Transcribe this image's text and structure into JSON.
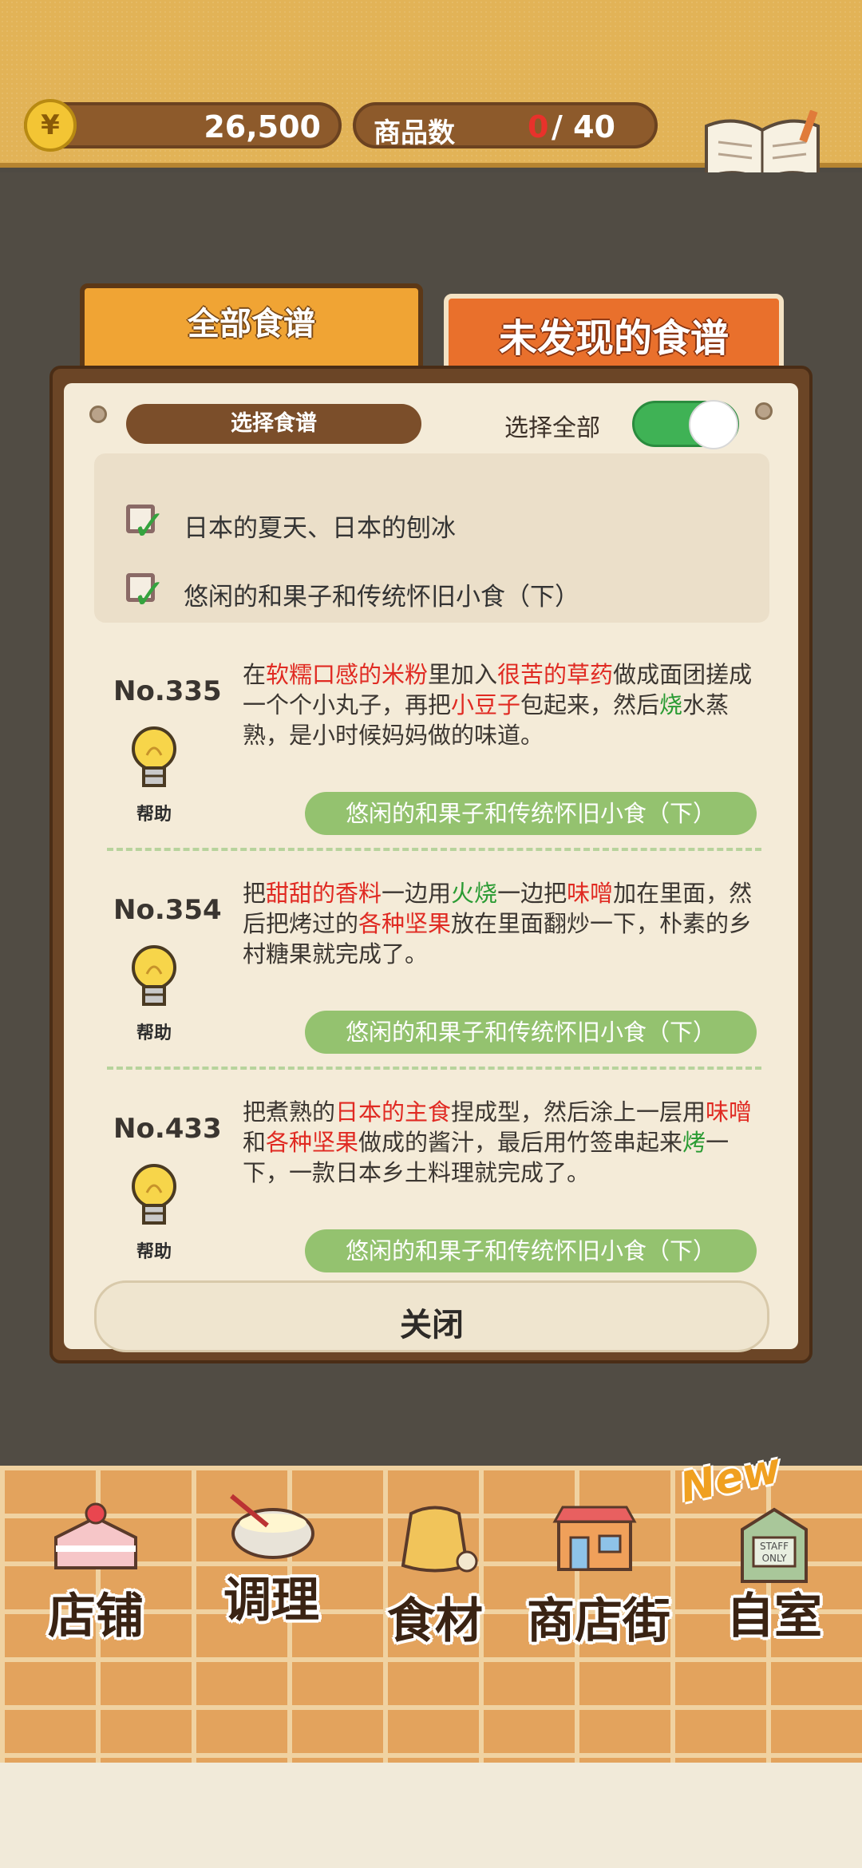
{
  "header": {
    "money": "26,500",
    "coin_symbol": "¥",
    "product_count_label": "商品数",
    "product_count_current": "0",
    "product_count_total": "/ 40",
    "recipe_button_label": "食谱"
  },
  "tabs": [
    {
      "label": "全部食谱",
      "active": false
    },
    {
      "label": "未发现的食谱",
      "active": true
    }
  ],
  "filter": {
    "select_label": "选择食谱",
    "select_all_label": "选择全部",
    "select_all_on": true,
    "items": [
      {
        "label": "日本的夏天、日本的刨冰",
        "checked": true
      },
      {
        "label": "悠闲的和果子和传统怀旧小食（下）",
        "checked": true
      }
    ]
  },
  "hint_label": "帮助",
  "recipes": [
    {
      "no": "No.335",
      "category": "悠闲的和果子和传统怀旧小食（下）",
      "desc_parts": [
        {
          "t": "在",
          "c": ""
        },
        {
          "t": "软糯口感的米粉",
          "c": "red"
        },
        {
          "t": "里加入",
          "c": ""
        },
        {
          "t": "很苦的草药",
          "c": "red"
        },
        {
          "t": "做成面团搓成一个个小丸子，再把",
          "c": ""
        },
        {
          "t": "小豆子",
          "c": "red"
        },
        {
          "t": "包起来，然后",
          "c": ""
        },
        {
          "t": "烧",
          "c": "green"
        },
        {
          "t": "水蒸熟，是小时候妈妈做的味道。",
          "c": ""
        }
      ]
    },
    {
      "no": "No.354",
      "category": "悠闲的和果子和传统怀旧小食（下）",
      "desc_parts": [
        {
          "t": "把",
          "c": ""
        },
        {
          "t": "甜甜的香料",
          "c": "red"
        },
        {
          "t": "一边用",
          "c": ""
        },
        {
          "t": "火烧",
          "c": "green"
        },
        {
          "t": "一边把",
          "c": ""
        },
        {
          "t": "味噌",
          "c": "red"
        },
        {
          "t": "加在里面，然后把烤过的",
          "c": ""
        },
        {
          "t": "各种坚果",
          "c": "red"
        },
        {
          "t": "放在里面翻炒一下，朴素的乡村糖果就完成了。",
          "c": ""
        }
      ]
    },
    {
      "no": "No.433",
      "category": "悠闲的和果子和传统怀旧小食（下）",
      "desc_parts": [
        {
          "t": "把煮熟的",
          "c": ""
        },
        {
          "t": "日本的主食",
          "c": "red"
        },
        {
          "t": "捏成型，然后涂上一层用",
          "c": ""
        },
        {
          "t": "味噌",
          "c": "red"
        },
        {
          "t": "和",
          "c": ""
        },
        {
          "t": "各种坚果",
          "c": "red"
        },
        {
          "t": "做成的酱汁，最后用竹签串起来",
          "c": ""
        },
        {
          "t": "烤",
          "c": "green"
        },
        {
          "t": "一下，一款日本乡土料理就完成了。",
          "c": ""
        }
      ]
    }
  ],
  "close_label": "关闭",
  "nav": [
    {
      "label": "店铺",
      "icon": "cake-icon"
    },
    {
      "label": "调理",
      "icon": "mixing-bowl-icon"
    },
    {
      "label": "食材",
      "icon": "flour-sack-icon"
    },
    {
      "label": "商店街",
      "icon": "shop-icon"
    },
    {
      "label": "自室",
      "icon": "staff-door-icon"
    }
  ],
  "new_badge": "New",
  "staff_sign": "STAFF ONLY",
  "colors": {
    "topbar": "#e2b357",
    "tab_active": "#e9702c",
    "tab_inactive": "#f0a434",
    "toggle_on": "#3fb255",
    "category_pill": "#94c26f",
    "highlight_red": "#e02a22",
    "highlight_green": "#2a9b33"
  }
}
